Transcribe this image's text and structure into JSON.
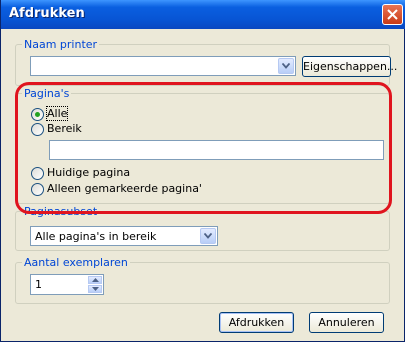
{
  "window": {
    "title": "Afdrukken"
  },
  "printer_group": {
    "legend": "Naam printer",
    "selected": "",
    "properties_button": "Eigenschappen..."
  },
  "pages_group": {
    "legend": "Pagina's",
    "options": [
      "Alle",
      "Bereik",
      "Huidige pagina",
      "Alleen gemarkeerde pagina'"
    ],
    "selected_index": 0,
    "range_value": ""
  },
  "subset_group": {
    "legend": "Paginasubset",
    "selected": "Alle pagina's in bereik"
  },
  "copies_group": {
    "legend": "Aantal exemplaren",
    "value": "1"
  },
  "buttons": {
    "print": "Afdrukken",
    "cancel": "Annuleren"
  },
  "colors": {
    "title_bar": "#0854d3",
    "legend_text": "#0046d5",
    "highlight": "#e0141e",
    "dialog_bg": "#ece9d8"
  },
  "icons": {
    "close": "close-icon",
    "dropdown": "chevron-down-icon",
    "spin_up": "arrow-up-icon",
    "spin_down": "arrow-down-icon"
  }
}
